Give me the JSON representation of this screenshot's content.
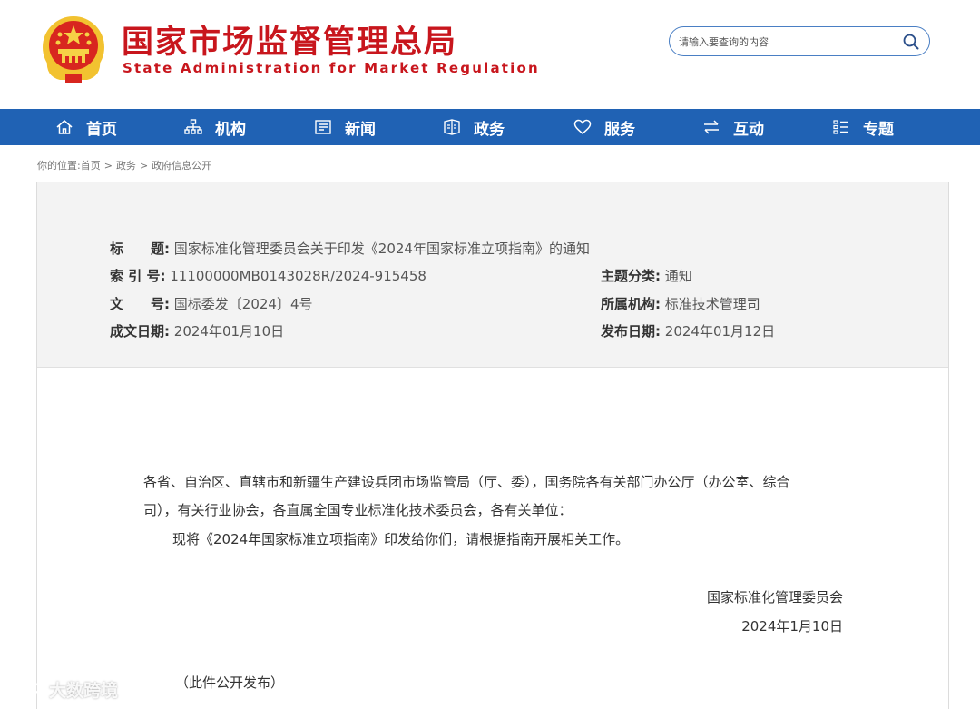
{
  "header": {
    "title": "国家市场监督管理总局",
    "subtitle": "State Administration for Market Regulation",
    "emblem_icon": "national-emblem-icon",
    "search": {
      "placeholder": "请输入要查询的内容",
      "icon": "search-icon"
    },
    "colors": {
      "brand_red": "#c8161d",
      "accent_blue": "#2062b4"
    }
  },
  "nav": {
    "items": [
      {
        "label": "首页",
        "icon": "home-icon"
      },
      {
        "label": "机构",
        "icon": "organization-icon"
      },
      {
        "label": "新闻",
        "icon": "news-icon"
      },
      {
        "label": "政务",
        "icon": "affairs-icon"
      },
      {
        "label": "服务",
        "icon": "heart-icon"
      },
      {
        "label": "互动",
        "icon": "exchange-arrows-icon"
      },
      {
        "label": "专题",
        "icon": "topic-list-icon"
      }
    ]
  },
  "breadcrumb": {
    "prefix": "你的位置:",
    "items": [
      "首页",
      "政务",
      "政府信息公开"
    ],
    "separator": ">"
  },
  "meta": {
    "title_label": "标　　题:",
    "title_value": "国家标准化管理委员会关于印发《2024年国家标准立项指南》的通知",
    "index_label": "索 引 号:",
    "index_value": "11100000MB0143028R/2024-915458",
    "topic_label": "主题分类:",
    "topic_value": "通知",
    "docno_label": "文　　号:",
    "docno_value": "国标委发〔2024〕4号",
    "org_label": "所属机构:",
    "org_value": "标准技术管理司",
    "created_label": "成文日期:",
    "created_value": "2024年01月10日",
    "published_label": "发布日期:",
    "published_value": "2024年01月12日"
  },
  "body": {
    "line1": "各省、自治区、直辖市和新疆生产建设兵团市场监管局（厅、委），国务院各有关部门办公厅（办公室、综合",
    "line2": "司），有关行业协会，各直属全国专业标准化技术委员会，各有关单位：",
    "line3": "现将《2024年国家标准立项指南》印发给你们，请根据指南开展相关工作。",
    "signature": "国家标准化管理委员会",
    "date": "2024年1月10日",
    "note": "（此件公开发布）"
  },
  "watermark": {
    "text": "大数跨境"
  }
}
